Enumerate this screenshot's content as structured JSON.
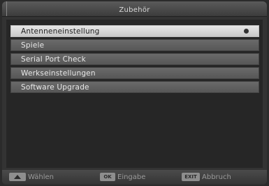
{
  "window": {
    "title": "Zubehör"
  },
  "menu": {
    "items": [
      {
        "label": "Antenneneinstellung",
        "selected": true,
        "icon": "gear-icon"
      },
      {
        "label": "Spiele",
        "selected": false
      },
      {
        "label": "Serial Port Check",
        "selected": false
      },
      {
        "label": "Werkseinstellungen",
        "selected": false
      },
      {
        "label": "Software Upgrade",
        "selected": false
      }
    ]
  },
  "footer": {
    "select": {
      "key": "",
      "label": "Wählen",
      "icon": "up-down-arrows-icon"
    },
    "ok": {
      "key": "OK",
      "label": "Eingabe"
    },
    "exit": {
      "key": "EXIT",
      "label": "Abbruch"
    }
  }
}
